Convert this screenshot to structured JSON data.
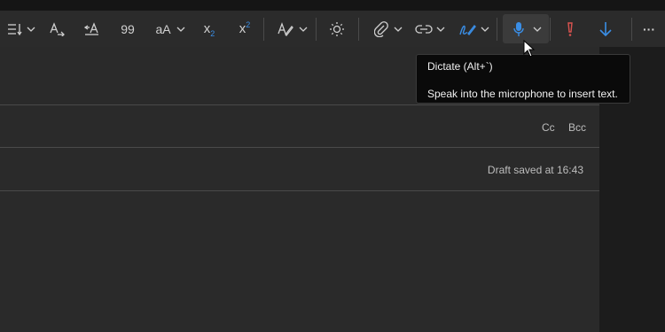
{
  "toolbar": {
    "buttons": [
      {
        "name": "bullets-menu",
        "icon": "list-indent-icon"
      },
      {
        "name": "text-direction",
        "icon": "text-direction-icon"
      },
      {
        "name": "line-spacing",
        "icon": "line-spacing-icon"
      },
      {
        "name": "quote",
        "label": "99"
      },
      {
        "name": "change-case",
        "label": "aA"
      },
      {
        "name": "subscript",
        "icon": "subscript-icon",
        "label": "x",
        "sub": "2"
      },
      {
        "name": "superscript",
        "icon": "superscript-icon",
        "label": "x",
        "sup": "2"
      },
      {
        "name": "styles",
        "icon": "pen-style-icon"
      },
      {
        "name": "immersive",
        "icon": "sun-icon"
      },
      {
        "name": "attach",
        "icon": "paperclip-icon"
      },
      {
        "name": "link",
        "icon": "link-icon"
      },
      {
        "name": "signature",
        "icon": "signature-pen-icon"
      },
      {
        "name": "dictate",
        "icon": "microphone-icon"
      },
      {
        "name": "importance-high",
        "icon": "exclamation-icon"
      },
      {
        "name": "importance-low",
        "icon": "arrow-down-icon"
      },
      {
        "name": "more",
        "icon": "ellipsis-icon"
      }
    ],
    "labels": {
      "quote": "99",
      "case": "aA",
      "sub_x": "x",
      "sub_2": "2",
      "sup_x": "x",
      "sup_2": "2",
      "more": "···"
    }
  },
  "tooltip": {
    "title": "Dictate (Alt+`)",
    "description": "Speak into the microphone to insert text."
  },
  "compose": {
    "cc_label": "Cc",
    "bcc_label": "Bcc",
    "draft_status": "Draft saved at 16:43"
  },
  "colors": {
    "accent_blue": "#3a8ee6",
    "importance_red": "#d9534f",
    "background": "#2a2a2a",
    "toolbar": "#2b2b2b"
  }
}
